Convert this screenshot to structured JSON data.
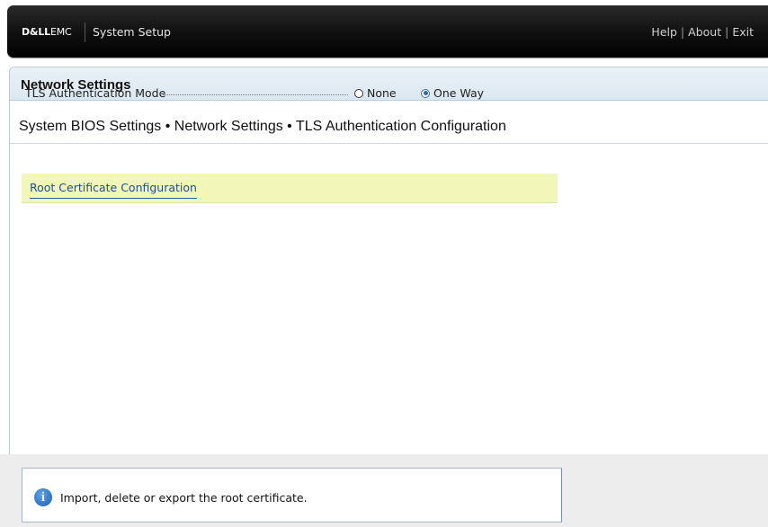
{
  "topbar": {
    "logo_bold": "D&LL",
    "logo_rest": "EMC",
    "app_title": "System Setup",
    "links": [
      "Help",
      "About",
      "Exit"
    ]
  },
  "header": {
    "title": "Network Settings"
  },
  "breadcrumb": "System BIOS Settings • Network Settings • TLS Authentication Configuration",
  "tls_mode": {
    "label": "TLS Authentication Mode",
    "options": [
      "None",
      "One Way"
    ],
    "selected": "One Way"
  },
  "root_cert": {
    "label": "Root Certificate Configuration"
  },
  "help": {
    "text": "Import, delete or export the root certificate."
  },
  "colors": {
    "accent": "#2f68b5",
    "highlight": "#f1f7b8",
    "header_bg": "#dce8f1"
  }
}
